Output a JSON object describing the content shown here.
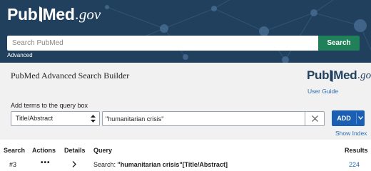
{
  "header": {
    "logo": {
      "pub": "Pub",
      "med": "Med",
      "gov": ".gov"
    },
    "search": {
      "placeholder": "Search PubMed",
      "value": ""
    },
    "search_button": "Search",
    "advanced_link": "Advanced"
  },
  "builder": {
    "title": "PubMed Advanced Search Builder",
    "brand_logo": {
      "pub": "Pub",
      "med": "Med",
      "gov": ".gov"
    },
    "user_guide": "User Guide",
    "add_terms_label": "Add terms to the query box",
    "field_select": {
      "selected": "Title/Abstract"
    },
    "term_input": {
      "value": "\"humanitarian crisis\""
    },
    "add_button": "ADD",
    "show_index": "Show Index"
  },
  "history": {
    "columns": {
      "search": "Search",
      "actions": "Actions",
      "details": "Details",
      "query": "Query",
      "results": "Results"
    },
    "rows": [
      {
        "number": "#3",
        "actions_glyph": "•••",
        "query_prefix": "Search: ",
        "query_text": "\"humanitarian crisis\"[Title/Abstract]",
        "results": "224"
      }
    ]
  },
  "colors": {
    "header_bg": "#20405e",
    "search_button_bg": "#20805a",
    "builder_bg": "#f1f1f1",
    "add_button_bg": "#1a5fb4",
    "link": "#2a6bb0"
  },
  "icons": {
    "book": "book-icon",
    "select_arrows": "sort-arrows-icon",
    "clear": "close-icon",
    "add_dropdown": "chevron-down-icon",
    "row_actions": "more-horizontal-icon",
    "row_details": "chevron-right-icon"
  }
}
